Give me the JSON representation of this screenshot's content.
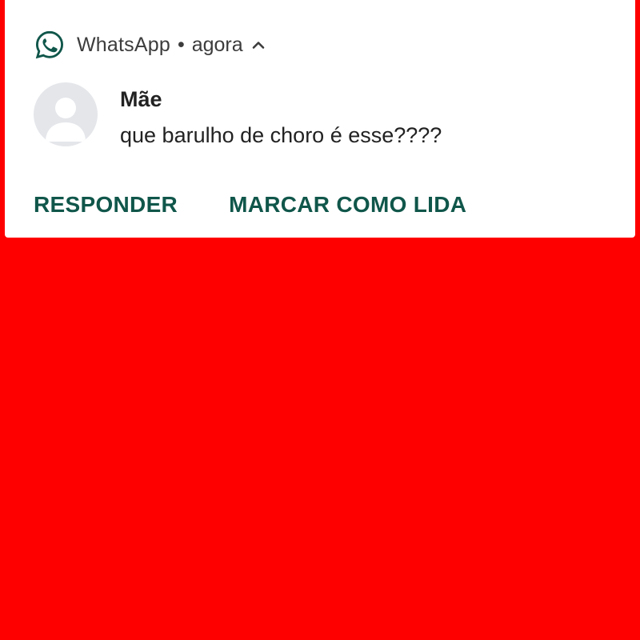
{
  "notification": {
    "app_name": "WhatsApp",
    "separator": "•",
    "time": "agora",
    "app_icon": "whatsapp-icon",
    "expand_icon": "chevron-up-icon",
    "sender": "Mãe",
    "message": "que barulho de choro é esse????",
    "avatar_icon": "default-avatar-icon",
    "actions": [
      {
        "label": "RESPONDER"
      },
      {
        "label": "MARCAR COMO LIDA"
      }
    ]
  },
  "colors": {
    "background": "#ff0000",
    "card": "#ffffff",
    "action_text": "#10564a",
    "whatsapp_icon": "#10564a",
    "avatar_bg": "#e4e6ea",
    "avatar_fg": "#ffffff"
  }
}
